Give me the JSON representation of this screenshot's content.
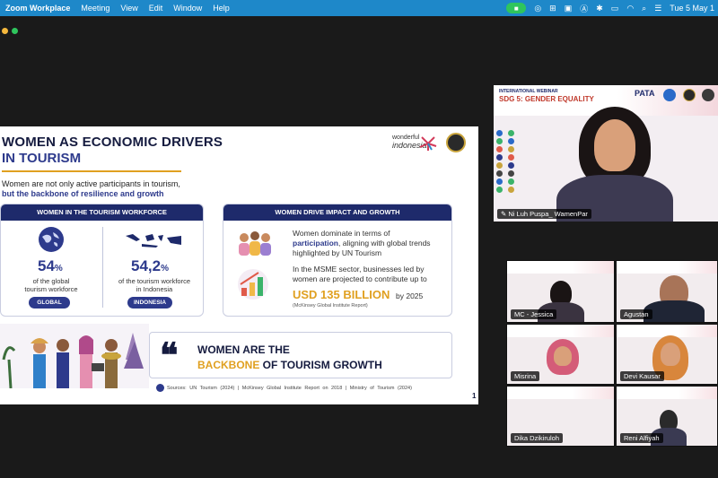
{
  "menubar": {
    "app": "Zoom Workplace",
    "menus": [
      "Meeting",
      "View",
      "Edit",
      "Window",
      "Help"
    ],
    "clock": "Tue 5 May 1"
  },
  "slide": {
    "title_line1": "WOMEN AS ECONOMIC DRIVERS",
    "title_line2": "IN TOURISM",
    "subtitle_line1": "Women are not only active participants in tourism,",
    "subtitle_line2": "but the backbone of resilience and growth",
    "logo_text_1": "wonderful",
    "logo_text_2": "indonesia",
    "card1": {
      "header": "WOMEN IN THE TOURISM WORKFORCE",
      "stat_global": "54",
      "stat_global_unit": "%",
      "cap_global_1": "of the global",
      "cap_global_2": "tourism workforce",
      "pill_global": "GLOBAL",
      "stat_indonesia": "54,2",
      "stat_indonesia_unit": "%",
      "cap_indonesia_1": "of the tourism workforce",
      "cap_indonesia_2": "in Indonesia",
      "pill_indonesia": "INDONESIA"
    },
    "card2": {
      "header": "WOMEN DRIVE IMPACT AND GROWTH",
      "p1_a": "Women dominate in terms of",
      "p1_b": "participation",
      "p1_c": ", aligning with global trends",
      "p1_d": "highlighted by UN Tourism",
      "p2_a": "In the MSME sector, businesses led by",
      "p2_b": "women are projected to contribute up to",
      "usd": "USD 135 BILLION",
      "usd_tail": "by 2025",
      "source_note": "(McKinsey Global Institute Report)"
    },
    "quote_line1": "WOMEN ARE THE",
    "quote_line2_hl": "BACKBONE",
    "quote_line2_rest": " OF TOURISM GROWTH",
    "sources": "Sources: UN Tourism (2024)   |   McKinsey Global Institute Report on 2018   |   Ministry of Tourism (2024)",
    "page_number": "1"
  },
  "participants": {
    "main": "Ni Luh Puspa_ WamenPar",
    "tiles": [
      "MC - Jessica",
      "Agustan",
      "Misrina",
      "Devi Kausar",
      "Dika Dzikiruloh",
      "Reni Alfiyah"
    ]
  },
  "webinar_banner": {
    "line1": "INTERNATIONAL WEBINAR",
    "line2": "SDG 5: GENDER EQUALITY",
    "org": "PATA"
  },
  "colors": {
    "menubar": "#1e88c9",
    "navy": "#1e2a6b",
    "accent_gold": "#e0a020"
  }
}
